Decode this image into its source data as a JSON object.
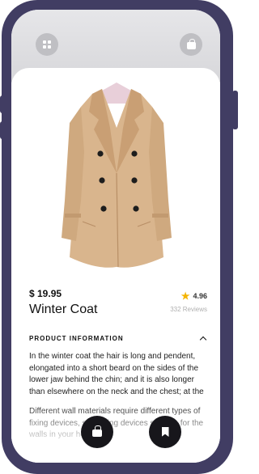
{
  "product": {
    "price": "$ 19.95",
    "name": "Winter Coat",
    "rating": "4.96",
    "reviews": "332 Reviews"
  },
  "section": {
    "title": "PRODUCT INFORMATION"
  },
  "description": {
    "paragraph1": "In the winter coat the hair is long and pendent, elongated into a short beard on the sides of the lower jaw behind the chin; and it is also longer than elsewhere on the neck and the chest; at the",
    "paragraph2": "Different wall materials require different types of fixing devices, so picking devices suitable for the walls in your house."
  },
  "icons": {
    "top_left": "grid-icon",
    "top_right": "bag-icon",
    "star": "star-icon",
    "chevron": "chevron-up-icon",
    "fab_left": "cart-icon",
    "fab_right": "bookmark-icon"
  },
  "colors": {
    "frame": "#413d63",
    "fab": "#17161b",
    "star": "#f4b400",
    "coat": "#d9b58d"
  }
}
